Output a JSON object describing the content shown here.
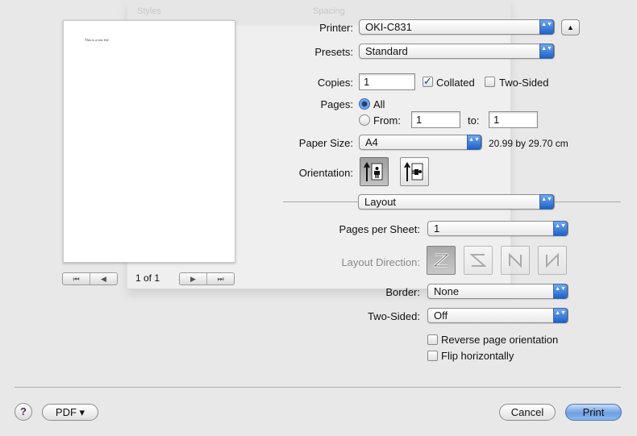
{
  "background": {
    "ghost_labels": [
      "Styles",
      "Spacing"
    ]
  },
  "preview": {
    "page_text": "This is a test file",
    "page_count": "1 of 1"
  },
  "printer": {
    "label": "Printer:",
    "value": "OKI-C831"
  },
  "presets": {
    "label": "Presets:",
    "value": "Standard"
  },
  "copies": {
    "label": "Copies:",
    "value": "1",
    "collated_label": "Collated",
    "collated": true,
    "two_sided_label": "Two-Sided",
    "two_sided": false
  },
  "pages": {
    "label": "Pages:",
    "all_label": "All",
    "from_label": "From:",
    "from_value": "1",
    "to_label": "to:",
    "to_value": "1"
  },
  "paper_size": {
    "label": "Paper Size:",
    "value": "A4",
    "dimensions": "20.99 by 29.70 cm"
  },
  "orientation": {
    "label": "Orientation:",
    "selected": "portrait"
  },
  "section": {
    "value": "Layout"
  },
  "layout": {
    "pages_per_sheet_label": "Pages per Sheet:",
    "pages_per_sheet_value": "1",
    "direction_label": "Layout Direction:",
    "border_label": "Border:",
    "border_value": "None",
    "two_sided_label": "Two-Sided:",
    "two_sided_value": "Off",
    "reverse_label": "Reverse page orientation",
    "flip_label": "Flip horizontally"
  },
  "footer": {
    "help": "?",
    "pdf_label": "PDF ▾",
    "cancel_label": "Cancel",
    "print_label": "Print"
  },
  "icons": {
    "nav": [
      "⏮",
      "◀",
      "▶",
      "⏭"
    ],
    "popup_arrows": "▲▼",
    "disclosure": "▲",
    "check": "✓"
  }
}
